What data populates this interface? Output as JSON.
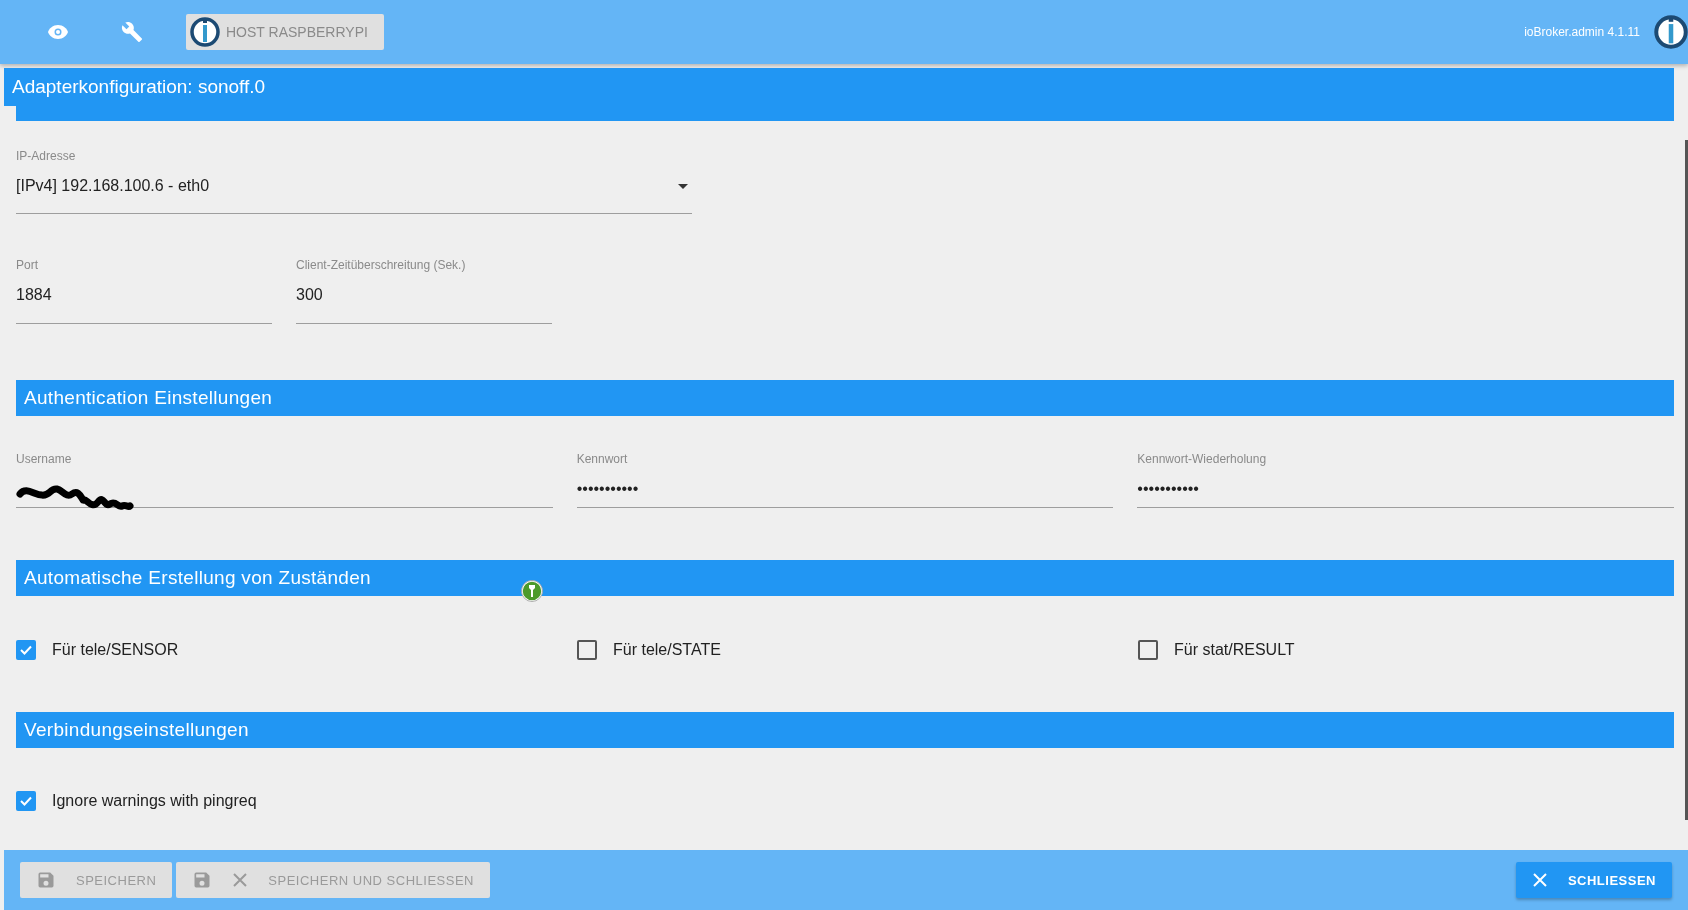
{
  "top_bar": {
    "host_button": "HOST RASPBERRYPI",
    "version": "ioBroker.admin 4.1.11"
  },
  "dialog": {
    "title": "Adapterkonfiguration: sonoff.0",
    "ip": {
      "label": "IP-Adresse",
      "value": "[IPv4] 192.168.100.6 - eth0"
    },
    "port": {
      "label": "Port",
      "value": "1884"
    },
    "timeout": {
      "label": "Client-Zeitüberschreitung (Sek.)",
      "value": "300"
    },
    "sections": [
      {
        "title": "Authentication Einstellungen",
        "fields": [
          {
            "label": "Username",
            "kind": "redacted"
          },
          {
            "label": "Kennwort",
            "kind": "password",
            "value": "•••••••••••"
          },
          {
            "label": "Kennwort-Wiederholung",
            "kind": "password",
            "value": "•••••••••••"
          }
        ]
      },
      {
        "title": "Automatische Erstellung von Zuständen",
        "checkboxes": [
          {
            "label": "Für tele/SENSOR",
            "checked": true
          },
          {
            "label": "Für tele/STATE",
            "checked": false
          },
          {
            "label": "Für stat/RESULT",
            "checked": false
          }
        ]
      },
      {
        "title": "Verbindungseinstellungen",
        "checkboxes": [
          {
            "label": "Ignore warnings with pingreq",
            "checked": true
          }
        ]
      }
    ]
  },
  "footer": {
    "save": "SPEICHERN",
    "save_close": "SPEICHERN UND SCHLIESSEN",
    "close": "SCHLIESSEN"
  }
}
